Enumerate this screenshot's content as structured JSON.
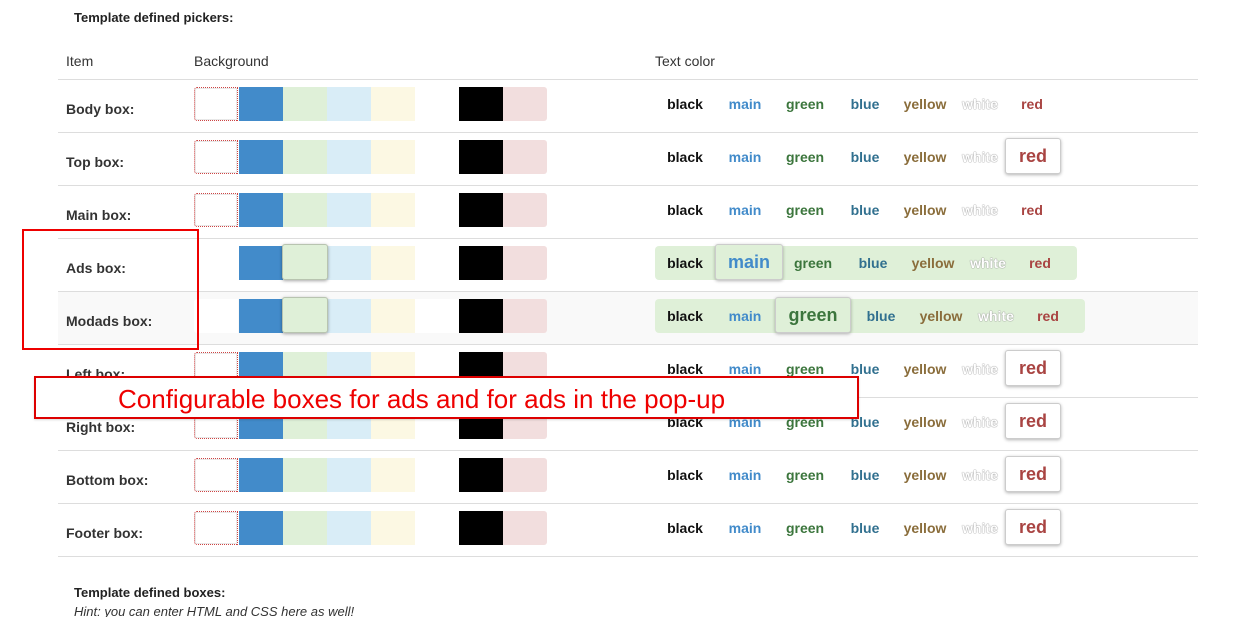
{
  "section_title": "Template defined pickers:",
  "headers": {
    "item": "Item",
    "background": "Background",
    "text_color": "Text color"
  },
  "colors": {
    "main": "#428bca",
    "green": "#dff0d8",
    "blue": "#d9edf7",
    "yellow": "#fcf8e3",
    "white": "#ffffff",
    "black": "#000000",
    "red": "#f2dede"
  },
  "text_options": [
    {
      "key": "black",
      "label": "black",
      "color": "#111111"
    },
    {
      "key": "main",
      "label": "main",
      "color": "#428bca"
    },
    {
      "key": "green",
      "label": "green",
      "color": "#3c763d"
    },
    {
      "key": "blue",
      "label": "blue",
      "color": "#31708f"
    },
    {
      "key": "yellow",
      "label": "yellow",
      "color": "#8a6d3b"
    },
    {
      "key": "white",
      "label": "white",
      "color": "#ffffff"
    },
    {
      "key": "red",
      "label": "red",
      "color": "#a94442"
    }
  ],
  "rows": [
    {
      "label": "Body box:",
      "bg": "empty",
      "text": "none"
    },
    {
      "label": "Top box:",
      "bg": "empty",
      "text": "red"
    },
    {
      "label": "Main box:",
      "bg": "empty",
      "text": "none"
    },
    {
      "label": "Ads box:",
      "bg": "green",
      "text": "main"
    },
    {
      "label": "Modads box:",
      "bg": "green",
      "text": "green"
    },
    {
      "label": "Left box:",
      "bg": "empty",
      "text": "red"
    },
    {
      "label": "Right box:",
      "bg": "empty",
      "text": "red"
    },
    {
      "label": "Bottom box:",
      "bg": "empty",
      "text": "red"
    },
    {
      "label": "Footer box:",
      "bg": "empty",
      "text": "red"
    }
  ],
  "annotation": {
    "text": "Configurable boxes for ads and for ads in the pop-up"
  },
  "bottom_title": "Template defined boxes:",
  "hint": "Hint: you can enter HTML and CSS here as well!"
}
